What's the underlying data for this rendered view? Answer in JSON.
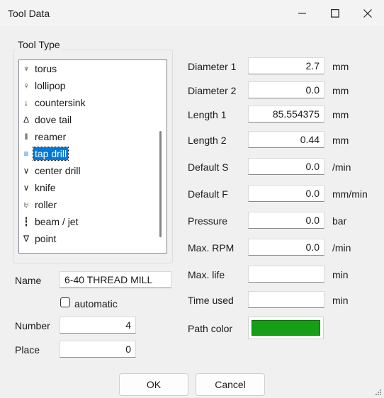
{
  "window": {
    "title": "Tool Data",
    "accent": "#0078d7"
  },
  "tool_type": {
    "label": "Tool Type",
    "items": [
      {
        "label": "torus",
        "icon": "torus-tool-icon"
      },
      {
        "label": "lollipop",
        "icon": "lollipop-tool-icon"
      },
      {
        "label": "countersink",
        "icon": "countersink-tool-icon"
      },
      {
        "label": "dove tail",
        "icon": "dovetail-tool-icon"
      },
      {
        "label": "reamer",
        "icon": "reamer-tool-icon"
      },
      {
        "label": "tap drill",
        "icon": "tap-drill-tool-icon",
        "selected": true
      },
      {
        "label": "center drill",
        "icon": "center-drill-tool-icon"
      },
      {
        "label": "knife",
        "icon": "knife-tool-icon"
      },
      {
        "label": "roller",
        "icon": "roller-tool-icon"
      },
      {
        "label": "beam / jet",
        "icon": "beam-jet-tool-icon"
      },
      {
        "label": "point",
        "icon": "point-tool-icon"
      }
    ]
  },
  "left_form": {
    "name_label": "Name",
    "name_value": "6-40 THREAD MILL",
    "automatic_label": "automatic",
    "automatic_checked": false,
    "number_label": "Number",
    "number_value": "4",
    "place_label": "Place",
    "place_value": "0"
  },
  "params": {
    "diameter1": {
      "label": "Diameter 1",
      "value": "2.7",
      "unit": "mm"
    },
    "diameter2": {
      "label": "Diameter 2",
      "value": "0.0",
      "unit": "mm"
    },
    "length1": {
      "label": "Length 1",
      "value": "85.554375",
      "unit": "mm"
    },
    "length2": {
      "label": "Length 2",
      "value": "0.44",
      "unit": "mm"
    },
    "default_s": {
      "label": "Default S",
      "value": "0.0",
      "unit": "/min"
    },
    "default_f": {
      "label": "Default F",
      "value": "0.0",
      "unit": "mm/min"
    },
    "pressure": {
      "label": "Pressure",
      "value": "0.0",
      "unit": "bar"
    },
    "max_rpm": {
      "label": "Max. RPM",
      "value": "0.0",
      "unit": "/min"
    },
    "max_life": {
      "label": "Max. life",
      "value": "",
      "unit": "min"
    },
    "time_used": {
      "label": "Time used",
      "value": "",
      "unit": "min"
    },
    "path_color": {
      "label": "Path color",
      "color": "#169f16"
    }
  },
  "buttons": {
    "ok": "OK",
    "cancel": "Cancel"
  }
}
